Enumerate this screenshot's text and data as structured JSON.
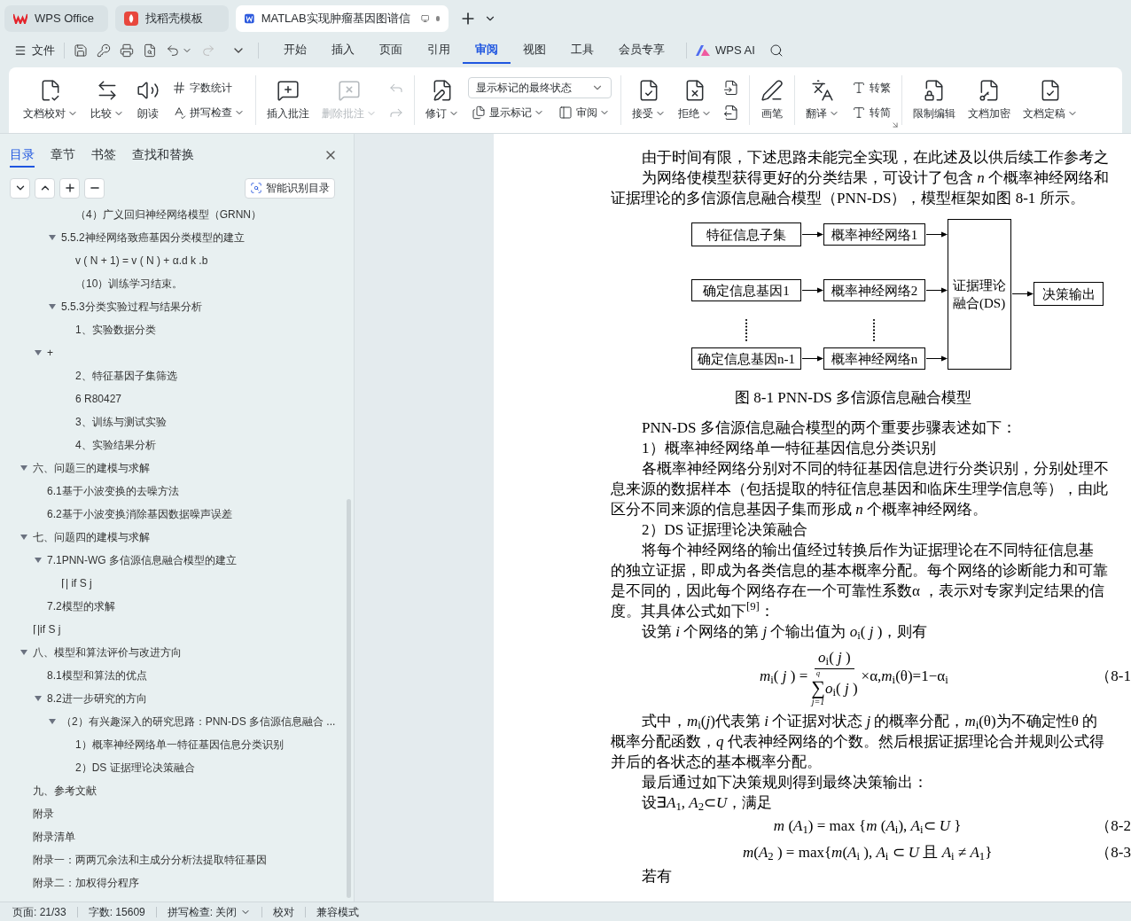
{
  "tabs": [
    {
      "label": "WPS Office",
      "selected": false
    },
    {
      "label": "找稻壳模板",
      "selected": false
    },
    {
      "label": "MATLAB实现肿瘤基因图谱信",
      "selected": true
    }
  ],
  "menu": {
    "file": "文件",
    "tabs": [
      {
        "label": "开始",
        "selected": false
      },
      {
        "label": "插入",
        "selected": false
      },
      {
        "label": "页面",
        "selected": false
      },
      {
        "label": "引用",
        "selected": false
      },
      {
        "label": "审阅",
        "selected": true
      },
      {
        "label": "视图",
        "selected": false
      },
      {
        "label": "工具",
        "selected": false
      },
      {
        "label": "会员专享",
        "selected": false
      }
    ],
    "ai": "WPS AI"
  },
  "ribbon": [
    [
      {
        "kind": "large",
        "label": "文档校对",
        "dropdown": true,
        "disabled": false
      },
      {
        "kind": "large",
        "label": "比较",
        "dropdown": true,
        "disabled": false
      },
      {
        "kind": "large",
        "label": "朗读",
        "dropdown": false,
        "disabled": false
      },
      {
        "kind": "stack",
        "items": [
          {
            "label": "字数统计",
            "dropdown": false,
            "disabled": false
          },
          {
            "label": "拼写检查",
            "dropdown": true,
            "disabled": false
          }
        ]
      }
    ],
    [
      {
        "kind": "large",
        "label": "插入批注",
        "dropdown": false,
        "disabled": false
      },
      {
        "kind": "large",
        "label": "删除批注",
        "dropdown": true,
        "disabled": true
      },
      {
        "kind": "stack",
        "items": [
          {
            "disabled": true
          },
          {
            "disabled": true
          }
        ]
      }
    ],
    [
      {
        "kind": "large",
        "label": "修订",
        "dropdown": true,
        "disabled": false
      },
      {
        "kind": "select",
        "value": "显示标记的最终状态",
        "items": [
          {
            "label": "显示标记",
            "dropdown": true,
            "disabled": false
          },
          {
            "label": "审阅",
            "dropdown": true,
            "disabled": false
          }
        ]
      }
    ],
    [
      {
        "kind": "large",
        "label": "接受",
        "dropdown": true,
        "disabled": false
      },
      {
        "kind": "large",
        "label": "拒绝",
        "dropdown": true,
        "disabled": false
      },
      {
        "kind": "stack",
        "items": [
          {
            "disabled": false
          },
          {
            "disabled": false
          }
        ]
      }
    ],
    [
      {
        "kind": "large",
        "label": "画笔",
        "dropdown": false,
        "disabled": false
      }
    ],
    [
      {
        "kind": "large",
        "label": "翻译",
        "dropdown": true,
        "disabled": false
      },
      {
        "kind": "stack",
        "items": [
          {
            "label": "转繁",
            "dropdown": false,
            "disabled": false
          },
          {
            "label": "转简",
            "dropdown": false,
            "disabled": false
          }
        ]
      }
    ],
    [
      {
        "kind": "large",
        "label": "限制编辑",
        "dropdown": false,
        "disabled": false
      },
      {
        "kind": "large",
        "label": "文档加密",
        "dropdown": false,
        "disabled": false
      },
      {
        "kind": "large",
        "label": "文档定稿",
        "dropdown": true,
        "disabled": false
      }
    ]
  ],
  "sidebar": {
    "tabs": [
      {
        "label": "目录",
        "selected": true
      },
      {
        "label": "章节",
        "selected": false
      },
      {
        "label": "书签",
        "selected": false
      },
      {
        "label": "查找和替换",
        "selected": false
      }
    ],
    "smart_button": "智能识别目录",
    "toc": [
      {
        "children": [
          {
            "children": [
              {
                "children": [
                  {
                    "text": "（4）广义回归神经网络模型（GRNN）"
                  }
                ]
              },
              {
                "text": "5.5.2神经网络致癌基因分类模型的建立",
                "expanded": true,
                "children": [
                  {
                    "text": "v ( N + 1) = v ( N ) + α.d k .b"
                  },
                  {
                    "text": "（10）训练学习结束。"
                  }
                ]
              },
              {
                "text": "5.5.3分类实验过程与结果分析",
                "expanded": true,
                "children": [
                  {
                    "text": "1、实验数据分类"
                  }
                ]
              }
            ]
          },
          {
            "text": "+",
            "expanded": true,
            "children": [
              {
                "children": [
                  {
                    "text": "2、特征基因子集筛选"
                  },
                  {
                    "text": "6  R80427"
                  },
                  {
                    "text": "3、训练与测试实验"
                  },
                  {
                    "text": "4、实验结果分析"
                  }
                ]
              }
            ]
          }
        ]
      },
      {
        "text": "六、问题三的建模与求解",
        "expanded": true,
        "children": [
          {
            "text": "6.1基于小波变换的去噪方法"
          },
          {
            "text": "6.2基于小波变换消除基因数据噪声误差"
          }
        ]
      },
      {
        "text": "七、问题四的建模与求解",
        "expanded": true,
        "children": [
          {
            "text": "7.1PNN-WG 多信源信息融合模型的建立",
            "expanded": true,
            "children": [
              {
                "text": "⌈| if  S j"
              }
            ]
          },
          {
            "text": "7.2模型的求解"
          }
        ]
      },
      {
        "text": "⌈|if  S j"
      },
      {
        "text": "八、模型和算法评价与改进方向",
        "expanded": true,
        "children": [
          {
            "text": "8.1模型和算法的优点"
          },
          {
            "text": "8.2进一步研究的方向",
            "expanded": true,
            "children": [
              {
                "text": "（2）有兴趣深入的研究思路：PNN-DS 多信源信息融合 ...",
                "expanded": true,
                "children": [
                  {
                    "text": "1）概率神经网络单一特征基因信息分类识别"
                  },
                  {
                    "text": "2）DS 证据理论决策融合"
                  }
                ]
              }
            ]
          }
        ]
      },
      {
        "text": "九、参考文献"
      },
      {
        "text": "附录"
      },
      {
        "text": "附录清单"
      },
      {
        "text": "附录一：两两冗余法和主成分分析法提取特征基因"
      },
      {
        "text": "附录二：加权得分程序"
      }
    ]
  },
  "document": [
    {
      "kind": "line",
      "indent": true,
      "text": "由于时间有限，下述思路未能完全实现，在此述及以供后续工作参考之"
    },
    {
      "kind": "line",
      "indent": true,
      "text": "为网络使模型获得更好的分类结果，可设计了包含 *n* 个概率神经网络和"
    },
    {
      "kind": "line",
      "indent": false,
      "text": "证据理论的多信源信息融合模型（PNN-DS），模型框架如图 8-1 所示。"
    },
    {
      "kind": "diagram",
      "nodes": [
        "特征信息子集",
        "确定信息基因1",
        "确定信息基因n-1",
        "概率神经网络1",
        "概率神经网络2",
        "概率神经网络n",
        "证据理论融合(DS)",
        "决策输出"
      ]
    },
    {
      "kind": "caption",
      "text": "图  8-1 PNN-DS 多信源信息融合模型"
    },
    {
      "kind": "line",
      "indent": true,
      "text": "PNN-DS 多信源信息融合模型的两个重要步骤表述如下："
    },
    {
      "kind": "line",
      "indent": true,
      "text": "1）概率神经网络单一特征基因信息分类识别"
    },
    {
      "kind": "line",
      "indent": true,
      "text": "各概率神经网络分别对不同的特征基因信息进行分类识别，分别处理不"
    },
    {
      "kind": "line",
      "indent": false,
      "text": "息来源的数据样本（包括提取的特征信息基因和临床生理学信息等），由此"
    },
    {
      "kind": "line",
      "indent": false,
      "text": "区分不同来源的信息基因子集而形成 *n* 个概率神经网络。"
    },
    {
      "kind": "line",
      "indent": true,
      "text": "2）DS 证据理论决策融合"
    },
    {
      "kind": "line",
      "indent": true,
      "text": "将每个神经网络的输出值经过转换后作为证据理论在不同特征信息基"
    },
    {
      "kind": "line",
      "indent": false,
      "text": "的独立证据，即成为各类信息的基本概率分配。每个网络的诊断能力和可靠"
    },
    {
      "kind": "line",
      "indent": false,
      "text": "是不同的，因此每个网络存在一个可靠性系数α ，表示对专家判定结果的信"
    },
    {
      "kind": "line",
      "indent": false,
      "text": "度。其具体公式如下$^{[9]}$："
    },
    {
      "kind": "line",
      "indent": true,
      "text": "设第 *i* 个网络的第 *j* 个输出值为 *o*$_{i}$( *j* )，则有"
    },
    {
      "kind": "fraction",
      "lhs": "*m*$_{i}$( *j* ) =",
      "numerator": "*o*$_{i}$( *j* )",
      "sum_top": "q",
      "sum": "∑",
      "sum_bottom": "j=1",
      "denominator": "*o*$_{i}$( *j* )",
      "rhs": "×α,*m*$_{i}$(θ)=1−α$_{i}$",
      "number": "（8-1"
    },
    {
      "kind": "line",
      "indent": true,
      "text": "式中，*m*$_{i}$(*j*)代表第 *i* 个证据对状态 *j* 的概率分配，*m*$_{i}$(θ)为不确定性θ 的"
    },
    {
      "kind": "line",
      "indent": false,
      "text": "概率分配函数，*q* 代表神经网络的个数。然后根据证据理论合并规则公式得"
    },
    {
      "kind": "line",
      "indent": false,
      "text": "并后的各状态的基本概率分配。"
    },
    {
      "kind": "line",
      "indent": true,
      "text": "最后通过如下决策规则得到最终决策输出："
    },
    {
      "kind": "line",
      "indent": true,
      "text": "设∃*A*$_{1}$, *A*$_{2}$⊂*U*，满足"
    },
    {
      "kind": "formula",
      "text": "*m* (*A*$_{1}$) = max {*m* (*A*$_{i}$), *A*$_{i}$⊂ *U* }",
      "number": "（8-2"
    },
    {
      "kind": "formula",
      "text": "*m*(*A*$_{2}$ ) = max{*m*(*A*$_{i}$ ), *A*$_{i}$ ⊂ *U* 且 *A*$_{i}$ ≠ *A*$_{1}$}",
      "number": "（8-3"
    },
    {
      "kind": "line",
      "indent": true,
      "text": "若有"
    }
  ],
  "status_bar": [
    {
      "text": "页面: 21/33",
      "dropdown": false
    },
    {
      "text": "字数: 15609",
      "dropdown": false
    },
    {
      "text": "拼写检查: 关闭",
      "dropdown": true
    },
    {
      "text": "校对",
      "dropdown": false
    },
    {
      "text": "兼容模式",
      "dropdown": false
    }
  ]
}
